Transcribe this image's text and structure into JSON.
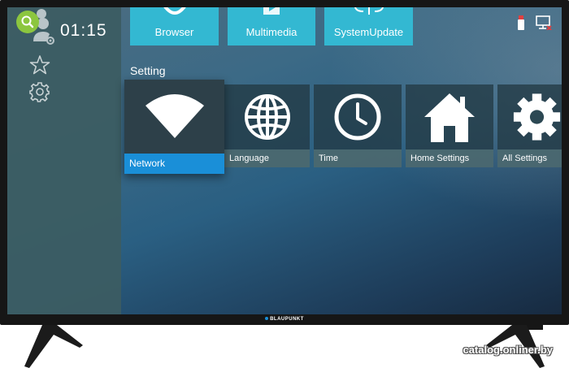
{
  "status_bar": {
    "time": "01:15"
  },
  "top_row": [
    {
      "label": "Browser",
      "icon": "browser-icon"
    },
    {
      "label": "Multimedia",
      "icon": "multimedia-icon"
    },
    {
      "label": "SystemUpdate",
      "icon": "system-update-icon"
    }
  ],
  "section": {
    "title": "Setting"
  },
  "settings_tiles": [
    {
      "label": "Network",
      "icon": "wifi-icon",
      "focused": true
    },
    {
      "label": "Language",
      "icon": "globe-icon"
    },
    {
      "label": "Time",
      "icon": "clock-icon"
    },
    {
      "label": "Home Settings",
      "icon": "home-icon"
    },
    {
      "label": "All Settings",
      "icon": "gear-icon"
    }
  ],
  "tv": {
    "brand": "BLAUPUNKT"
  },
  "watermark": "catalog.onliner.by",
  "colors": {
    "accent": "#1a8fd8",
    "top_tile": "#33b8d2",
    "search": "#8cc63f"
  }
}
